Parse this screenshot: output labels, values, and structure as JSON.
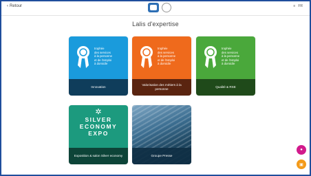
{
  "header": {
    "back_label": "Retour",
    "right_text": "FR"
  },
  "page": {
    "title": "Lalis d'expertise"
  },
  "cards": [
    {
      "award_lines": [
        "trophée",
        "des services",
        "à la personne",
        "et de l'emploi",
        "à domicile"
      ],
      "caption": "Innovation",
      "top_color": "#1a9bdc",
      "bottom_color": "#0f3d5b"
    },
    {
      "award_lines": [
        "trophée",
        "des services",
        "à la personne",
        "et de l'emploi",
        "à domicile"
      ],
      "caption": "Valorisation des métiers à la personne",
      "top_color": "#ef6a1c",
      "bottom_color": "#5a2410"
    },
    {
      "award_lines": [
        "trophée",
        "des services",
        "à la personne",
        "et de l'emploi",
        "à domicile"
      ],
      "caption": "Qualité & RSE",
      "top_color": "#4aa83b",
      "bottom_color": "#1f4a1a"
    },
    {
      "silver_lines": [
        "SILVER",
        "ECONOMY",
        "EXPO"
      ],
      "caption": "Exposition & salon Silver economy",
      "top_color": "#1c9a7e",
      "bottom_color": "#0d4438"
    },
    {
      "caption": "Groupe Presse",
      "bottom_color": "#0f2f44"
    }
  ],
  "fabs": {
    "chat_color": "#d21a8c",
    "help_color": "#f39a1a"
  }
}
